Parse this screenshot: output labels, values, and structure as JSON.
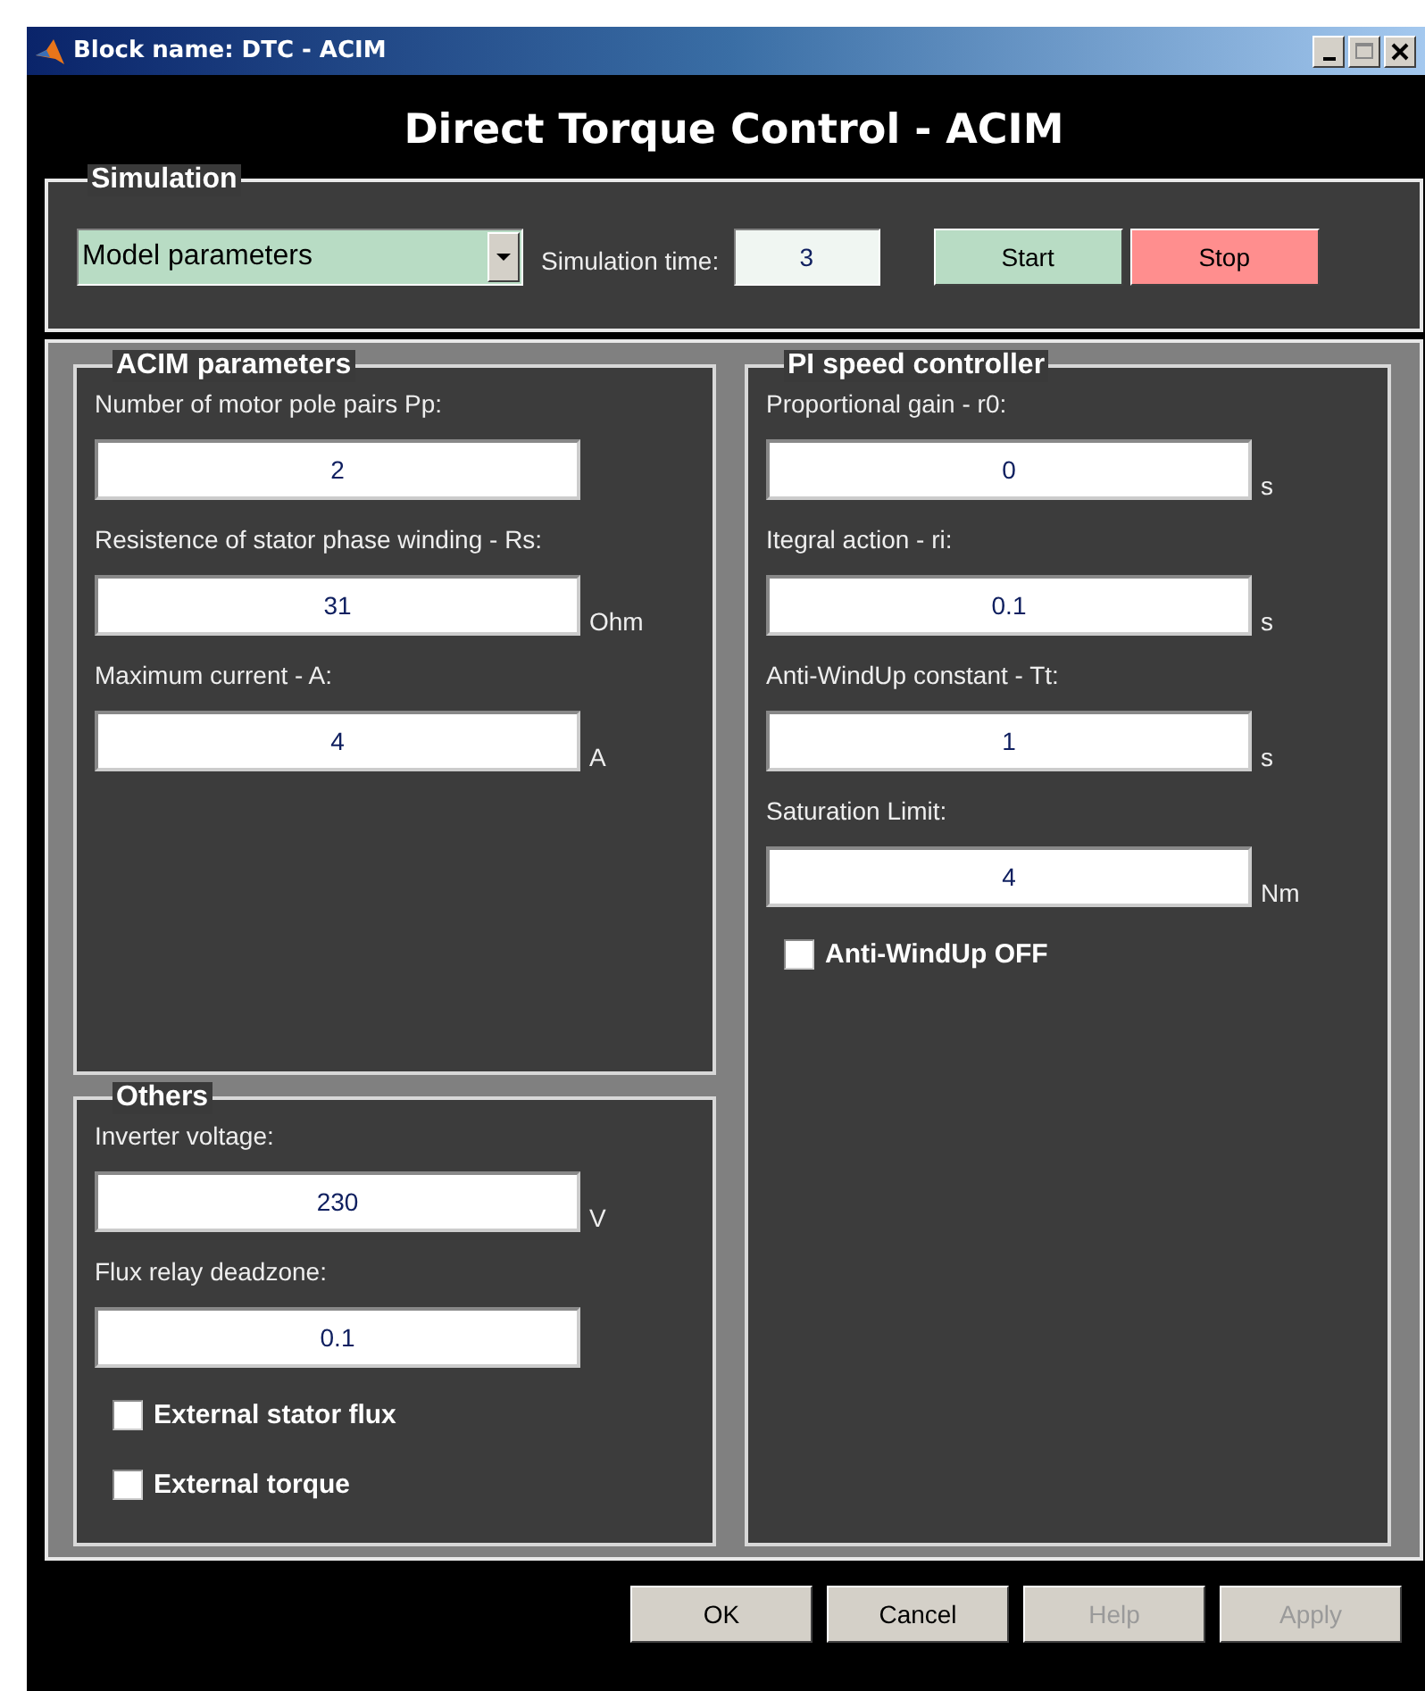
{
  "window": {
    "title": "Block name: DTC - ACIM"
  },
  "heading": "Direct Torque Control - ACIM",
  "simulation": {
    "title": "Simulation",
    "mode": "Model parameters",
    "time_label": "Simulation time:",
    "time_value": "3",
    "buttons": [
      {
        "label": "Start",
        "kind": "start"
      },
      {
        "label": "Stop",
        "kind": "stop"
      }
    ]
  },
  "left_column": [
    {
      "title": "ACIM parameters",
      "fields": [
        {
          "label": "Number of motor pole pairs Pp:",
          "value": "2"
        },
        {
          "label": "Resistence of stator phase winding - Rs:",
          "value": "31",
          "unit": "Ohm"
        },
        {
          "label": "Maximum current - A:",
          "value": "4",
          "unit": "A"
        }
      ]
    },
    {
      "title": "Others",
      "fields": [
        {
          "label": "Inverter voltage:",
          "value": "230",
          "unit": "V"
        },
        {
          "label": "Flux relay deadzone:",
          "value": "0.1"
        }
      ],
      "checkboxes": [
        {
          "label": "External stator flux",
          "checked": false
        },
        {
          "label": "External torque",
          "checked": false
        }
      ]
    }
  ],
  "right_column": [
    {
      "title": "PI speed controller",
      "fields": [
        {
          "label": "Proportional gain - r0:",
          "value": "0",
          "unit": "s"
        },
        {
          "label": "Itegral action - ri:",
          "value": "0.1",
          "unit": "s"
        },
        {
          "label": "Anti-WindUp constant - Tt:",
          "value": "1",
          "unit": "s"
        },
        {
          "label": "Saturation Limit:",
          "value": "4",
          "unit": "Nm"
        }
      ],
      "checkboxes": [
        {
          "label": "Anti-WindUp OFF",
          "checked": false
        }
      ]
    }
  ],
  "buttons": [
    {
      "label": "OK",
      "disabled": false
    },
    {
      "label": "Cancel",
      "disabled": false
    },
    {
      "label": "Help",
      "disabled": true
    },
    {
      "label": "Apply",
      "disabled": true
    }
  ]
}
